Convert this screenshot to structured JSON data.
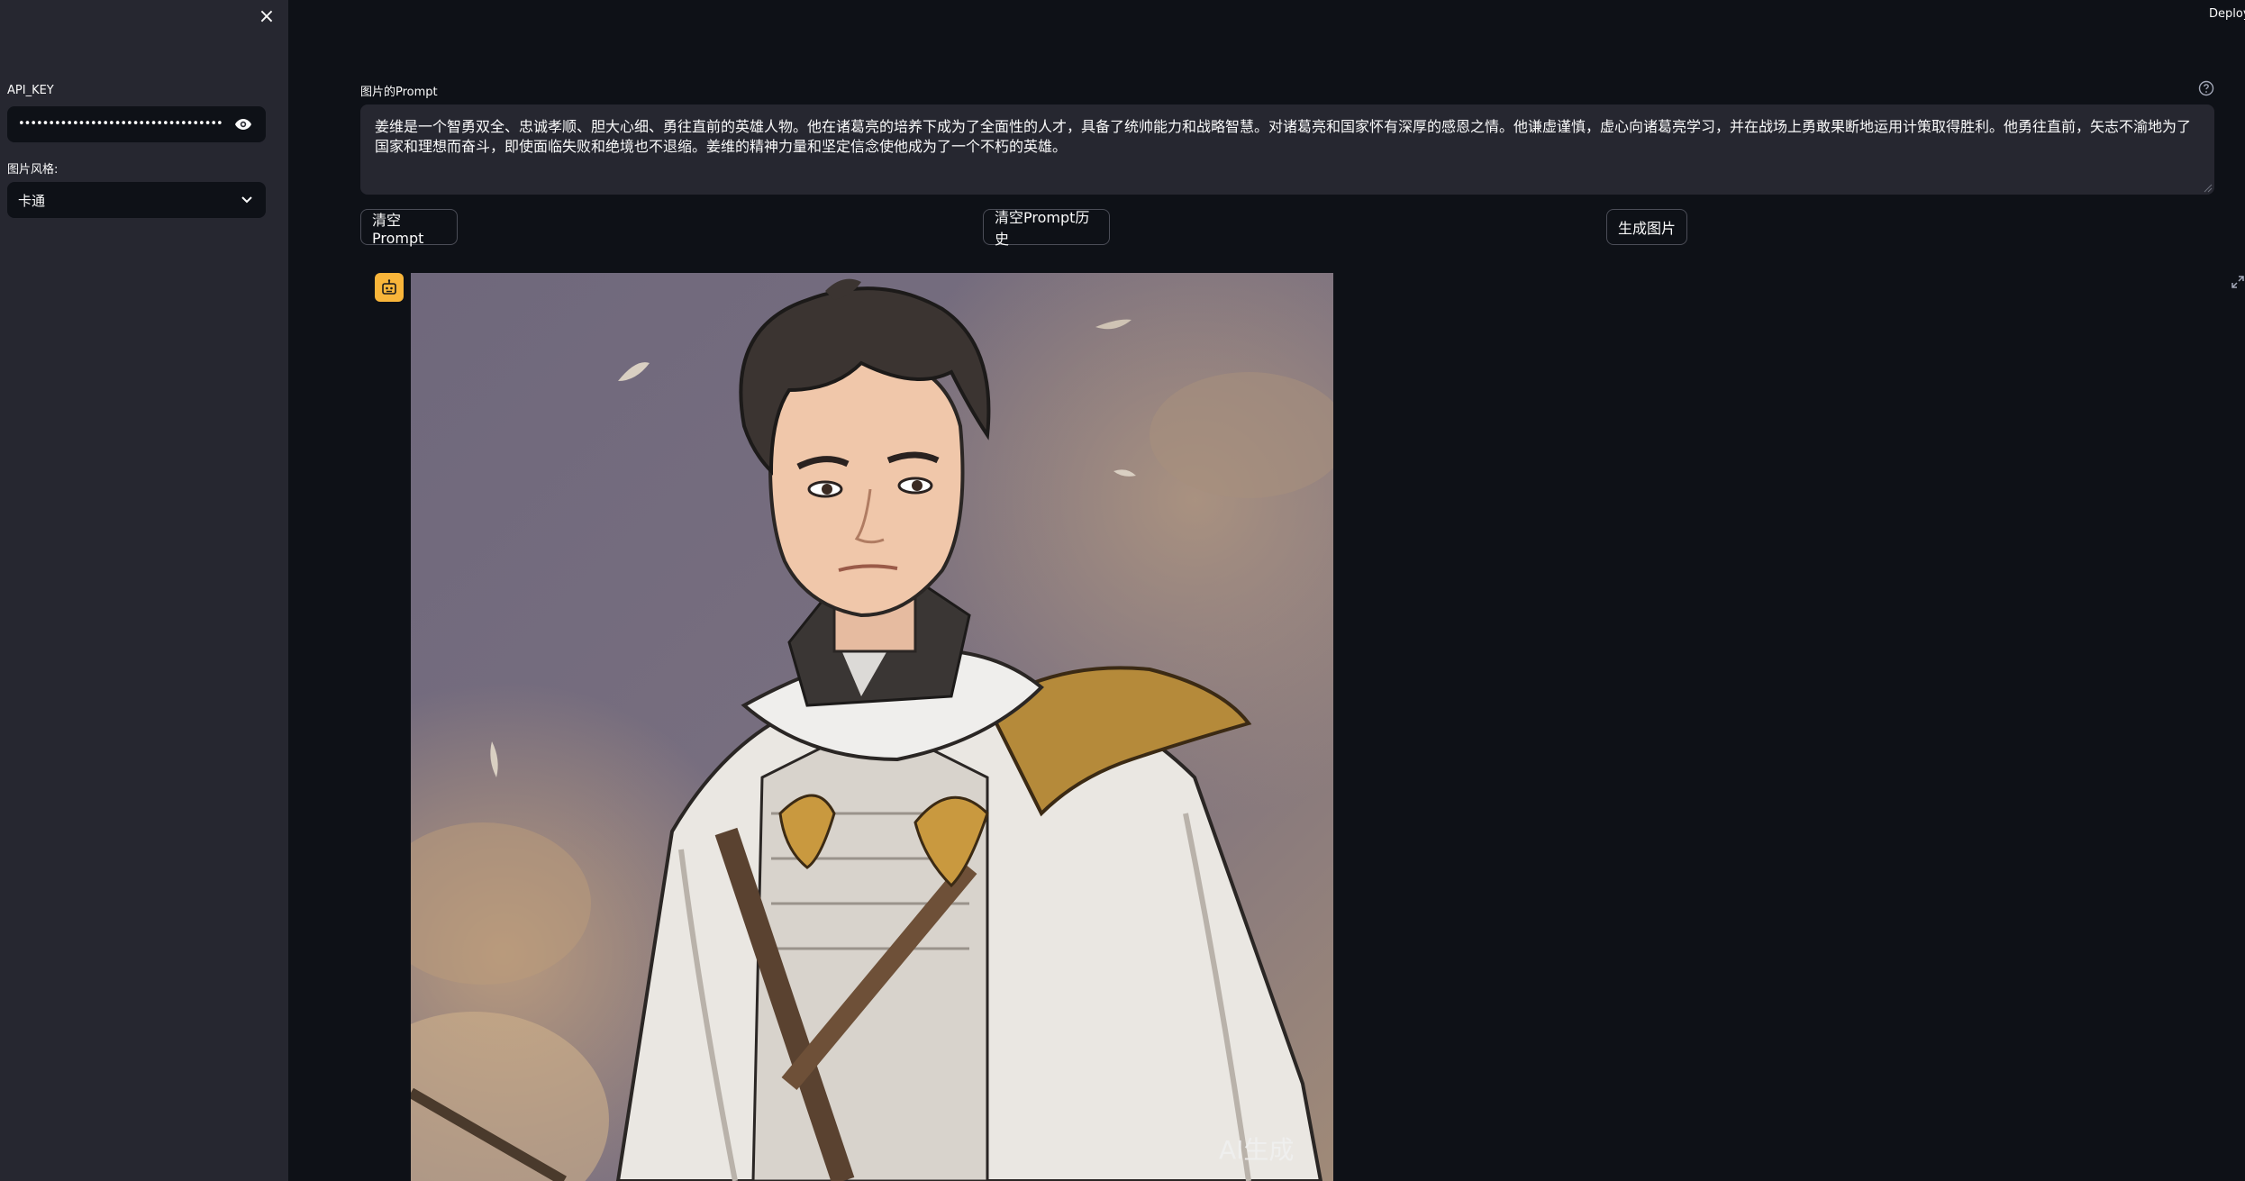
{
  "sidebar": {
    "close_glyph": "×",
    "api_key_label": "API_KEY",
    "api_key_value": "••••••••••••••••••••••••••••••••••••••••••••••••••••",
    "style_label": "图片风格:",
    "style_value": "卡通"
  },
  "header": {
    "deploy_label": "Deploy"
  },
  "main": {
    "prompt_label": "图片的Prompt",
    "prompt_text": "姜维是一个智勇双全、忠诚孝顺、胆大心细、勇往直前的英雄人物。他在诸葛亮的培养下成为了全面性的人才，具备了统帅能力和战略智慧。对诸葛亮和国家怀有深厚的感恩之情。他谦虚谨慎，虚心向诸葛亮学习，并在战场上勇敢果断地运用计策取得胜利。他勇往直前，矢志不渝地为了国家和理想而奋斗，即使面临失败和绝境也不退缩。姜维的精神力量和坚定信念使他成为了一个不朽的英雄。",
    "buttons": {
      "clear_prompt": "清空Prompt",
      "clear_history": "清空Prompt历史",
      "generate": "生成图片"
    },
    "image": {
      "watermark": "AI生成"
    }
  },
  "colors": {
    "background": "#0e1117",
    "sidebar": "#262730",
    "badge": "#f8b53a"
  }
}
